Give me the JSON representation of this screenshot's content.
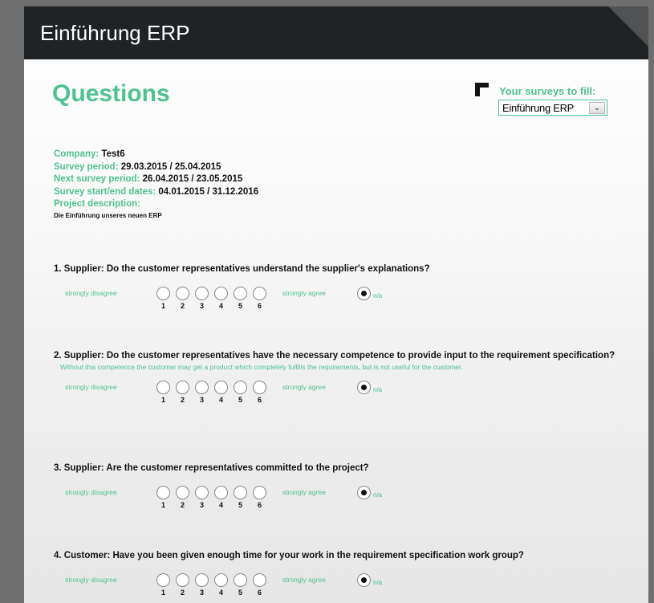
{
  "app": {
    "title": "Einführung ERP"
  },
  "page": {
    "title": "Questions"
  },
  "surveys": {
    "label": "Your surveys to fill:",
    "selected": "Einführung ERP"
  },
  "info": {
    "company_label": "Company:",
    "company": "Test6",
    "period_label": "Survey period:",
    "period": "29.03.2015 / 25.04.2015",
    "next_label": "Next survey period:",
    "next": "26.04.2015 / 23.05.2015",
    "dates_label": "Survey start/end dates:",
    "dates": "04.01.2015 / 31.12.2016",
    "desc_label": "Project description:",
    "desc": "Die Einführung unseres neuen ERP"
  },
  "scale": {
    "left": "strongly disagree",
    "right": "strongly agree",
    "na": "n/a",
    "numbers": [
      "1",
      "2",
      "3",
      "4",
      "5",
      "6"
    ]
  },
  "questions": [
    {
      "text": "1. Supplier: Do the customer representatives understand the supplier's explanations?",
      "hint": "",
      "selected": "n/a"
    },
    {
      "text": "2. Supplier: Do the customer representatives have the necessary competence to provide input to the requirement specification?",
      "hint": "Without this competence the customer may get a product which completely fulfills the requirements, but is not useful for the customer.",
      "selected": "n/a"
    },
    {
      "text": "3. Supplier: Are the customer representatives committed to the project?",
      "hint": "",
      "selected": "n/a"
    },
    {
      "text": "4. Customer: Have you been given enough time for your work in the requirement specification work group?",
      "hint": "",
      "selected": "n/a"
    }
  ],
  "colors": {
    "accent": "#4ec290",
    "header_bg": "#1f2326"
  }
}
